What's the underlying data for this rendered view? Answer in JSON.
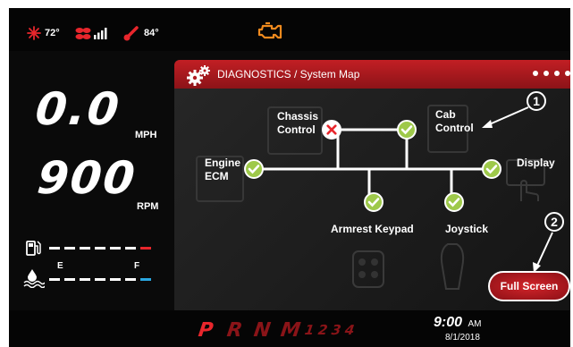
{
  "status": {
    "ac_temp": "72°",
    "outside_temp": "84°",
    "colors": {
      "red": "#e8262c",
      "amber": "#f08a1e",
      "white": "#ffffff"
    }
  },
  "gauges": {
    "speed_value": "0.0",
    "speed_unit": "MPH",
    "rpm_value": "900",
    "rpm_unit": "RPM",
    "fuel": {
      "empty_label": "E",
      "full_label": "F"
    }
  },
  "diagnostics": {
    "title": "DIAGNOSTICS / System Map",
    "nodes": {
      "chassis": {
        "line1": "Chassis",
        "line2": "Control",
        "status": "error"
      },
      "cab": {
        "line1": "Cab",
        "line2": "Control",
        "status": "ok"
      },
      "engine": {
        "line1": "Engine",
        "line2": "ECM",
        "status": "ok"
      },
      "display": {
        "label": "Display",
        "status": "ok"
      },
      "armrest": {
        "label": "Armrest Keypad",
        "status": "ok"
      },
      "joystick": {
        "label": "Joystick",
        "status": "ok"
      }
    },
    "fullscreen_label": "Full Screen",
    "callouts": [
      "1",
      "2"
    ]
  },
  "bottom": {
    "gears": [
      "P",
      "R",
      "N",
      "M",
      "1",
      "2",
      "3",
      "4"
    ],
    "time": "9:00",
    "ampm": "AM",
    "date": "8/1/2018"
  }
}
